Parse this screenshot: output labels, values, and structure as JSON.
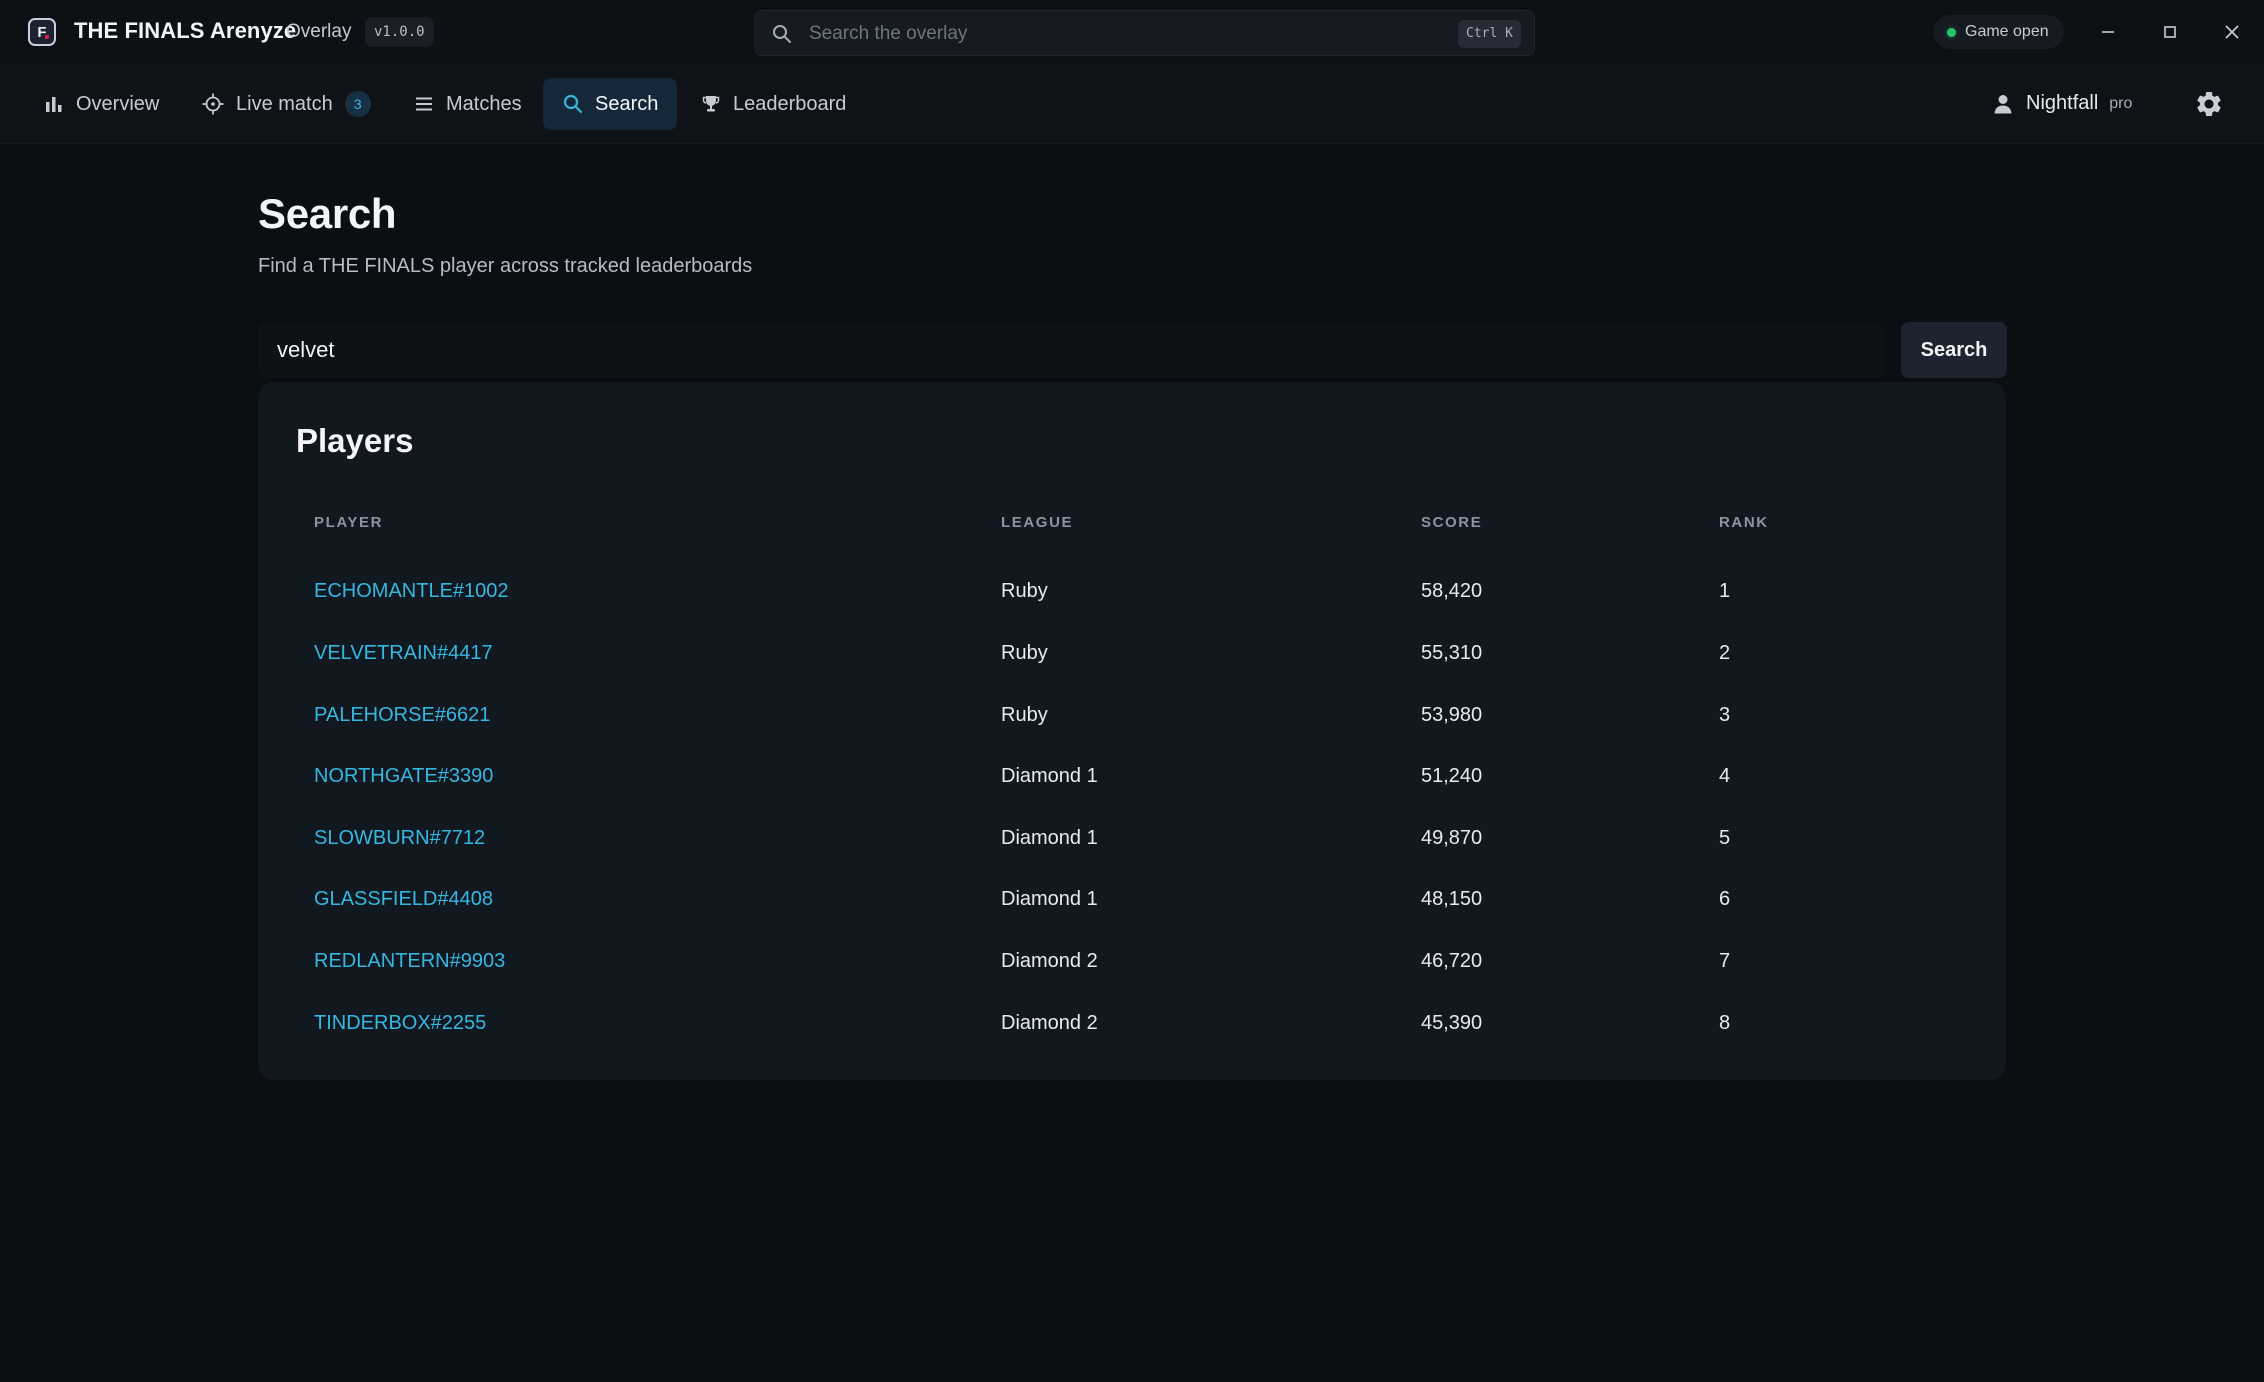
{
  "app": {
    "title": "THE FINALS Arenyze",
    "subtitle": "Overlay",
    "version": "v1.0.0",
    "logo_letter": "F"
  },
  "global_search": {
    "placeholder": "Search the overlay",
    "shortcut": "Ctrl K"
  },
  "status": {
    "label": "Game open",
    "color": "#27c46a"
  },
  "window_controls": [
    "minimize-icon",
    "maximize-icon",
    "close-icon"
  ],
  "nav": {
    "overview": "Overview",
    "live_match": "Live match",
    "live_match_count": "3",
    "matches": "Matches",
    "search": "Search",
    "leaderboard": "Leaderboard",
    "active": "Search"
  },
  "user": {
    "name": "Nightfall",
    "tier": "pro"
  },
  "page": {
    "title": "Search",
    "subtitle": "Find a THE FINALS player across tracked leaderboards"
  },
  "search": {
    "value": "velvet",
    "button_label": "Search"
  },
  "players": {
    "title": "Players",
    "columns": {
      "player": "PLAYER",
      "league": "LEAGUE",
      "score": "SCORE",
      "rank": "RANK"
    },
    "rows": [
      {
        "player": "ECHOMANTLE#1002",
        "league": "Ruby",
        "score": "58,420",
        "rank": "1"
      },
      {
        "player": "VELVETRAIN#4417",
        "league": "Ruby",
        "score": "55,310",
        "rank": "2"
      },
      {
        "player": "PALEHORSE#6621",
        "league": "Ruby",
        "score": "53,980",
        "rank": "3"
      },
      {
        "player": "NORTHGATE#3390",
        "league": "Diamond 1",
        "score": "51,240",
        "rank": "4"
      },
      {
        "player": "SLOWBURN#7712",
        "league": "Diamond 1",
        "score": "49,870",
        "rank": "5"
      },
      {
        "player": "GLASSFIELD#4408",
        "league": "Diamond 1",
        "score": "48,150",
        "rank": "6"
      },
      {
        "player": "REDLANTERN#9903",
        "league": "Diamond 2",
        "score": "46,720",
        "rank": "7"
      },
      {
        "player": "TINDERBOX#2255",
        "league": "Diamond 2",
        "score": "45,390",
        "rank": "8"
      }
    ]
  },
  "colors": {
    "accent": "#36b7e0",
    "background": "#0b0e13",
    "card": "#121820",
    "nav_active": "#15283a"
  }
}
